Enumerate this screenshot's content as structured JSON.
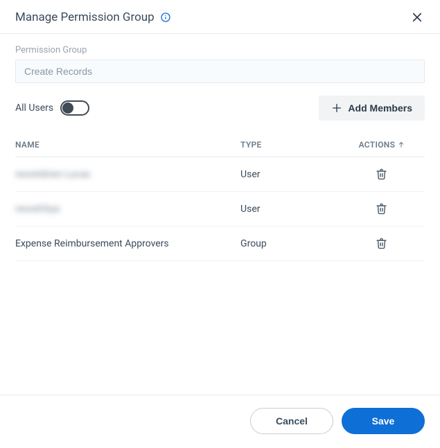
{
  "header": {
    "title": "Manage Permission Group"
  },
  "form": {
    "permission_group_label": "Permission Group",
    "permission_group_value": "Create Records"
  },
  "controls": {
    "all_users_label": "All Users",
    "all_users_on": false,
    "add_members_label": "Add Members"
  },
  "table": {
    "columns": {
      "name": "NAME",
      "type": "TYPE",
      "actions": "ACTIONS"
    },
    "sort_column": "actions",
    "sort_dir": "asc",
    "rows": [
      {
        "name": "reoretdrien Lucas",
        "type": "User",
        "obscured": true
      },
      {
        "name": "reoretOiya",
        "type": "User",
        "obscured": true
      },
      {
        "name": "Expense Reimbursement Approvers",
        "type": "Group",
        "obscured": false
      }
    ]
  },
  "footer": {
    "cancel": "Cancel",
    "save": "Save"
  },
  "colors": {
    "primary": "#0e6fd6",
    "icon": "#4a5a6a"
  }
}
